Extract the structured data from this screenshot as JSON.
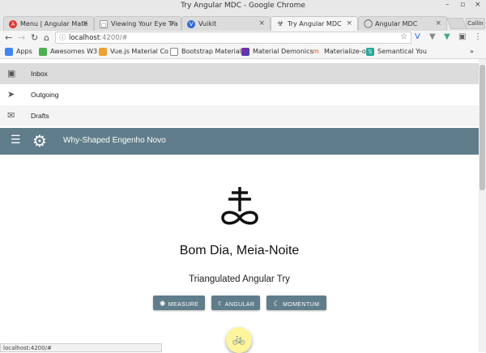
{
  "window": {
    "title": "Try Angular MDC - Google Chrome",
    "controls": [
      "–",
      "▫",
      "×"
    ]
  },
  "tabs": [
    {
      "label": "Menu | Angular Mate",
      "favicon": "A",
      "color": "#dd3333"
    },
    {
      "label": "Viewing Your Eye Tra",
      "favicon": "▢",
      "color": "#888888"
    },
    {
      "label": "Vuikit",
      "favicon": "V",
      "color": "#2b6bd9"
    },
    {
      "label": "Try Angular MDC",
      "favicon": "☣",
      "color": "#444444",
      "active": true
    },
    {
      "label": "Angular MDC",
      "favicon": "◯",
      "color": "#333333"
    }
  ],
  "tab_close_glyph": "×",
  "callin_label": "Callin",
  "address_bar": {
    "host": "localhost",
    "path": ":4200/#"
  },
  "bookmarks": [
    {
      "label": "Apps",
      "icon": "apps-icon",
      "color": "#4285f4"
    },
    {
      "label": "Awesomes W3",
      "icon": "w3-icon",
      "color": "#4caf50"
    },
    {
      "label": "Vue.js Material Co",
      "icon": "vue-icon",
      "color": "#f0a030"
    },
    {
      "label": "Bootstrap Material",
      "icon": "doc-icon",
      "color": "#888888"
    },
    {
      "label": "Material Demonics",
      "icon": "gradient-icon",
      "color": "#8e24aa"
    },
    {
      "label": "Materialize-o",
      "icon": "m-icon",
      "color": "#e64a19"
    },
    {
      "label": "Semantical You",
      "icon": "s-icon",
      "color": "#26a69a"
    }
  ],
  "bookmarks_overflow": "»",
  "drawer": [
    {
      "label": "Inbox",
      "icon": "▣",
      "icon_name": "inbox-icon",
      "bg": "#dcdcdc"
    },
    {
      "label": "Outgoing",
      "icon": "➤",
      "icon_name": "send-icon",
      "bg": "#ffffff"
    },
    {
      "label": "Drafts",
      "icon": "✉",
      "icon_name": "drafts-icon",
      "bg": "#f4f4f4"
    }
  ],
  "appbar": {
    "title": "Why-Shaped Engenho Novo",
    "menu_glyph": "☰",
    "logo_glyph": "⚙",
    "bg": "#607d8b"
  },
  "hero": {
    "headline": "Bom Dia, Meia-Noite",
    "subhead": "Triangulated Angular Try"
  },
  "buttons": [
    {
      "label": "MEASURE",
      "icon": "✺",
      "icon_name": "measure-icon"
    },
    {
      "label": "ANGULAR",
      "icon": "☿",
      "icon_name": "angular-icon"
    },
    {
      "label": "MOMENTUM",
      "icon": "☾",
      "icon_name": "momentum-icon"
    }
  ],
  "fab_glyph": "🚲",
  "status_url": "localhost:4200/#"
}
